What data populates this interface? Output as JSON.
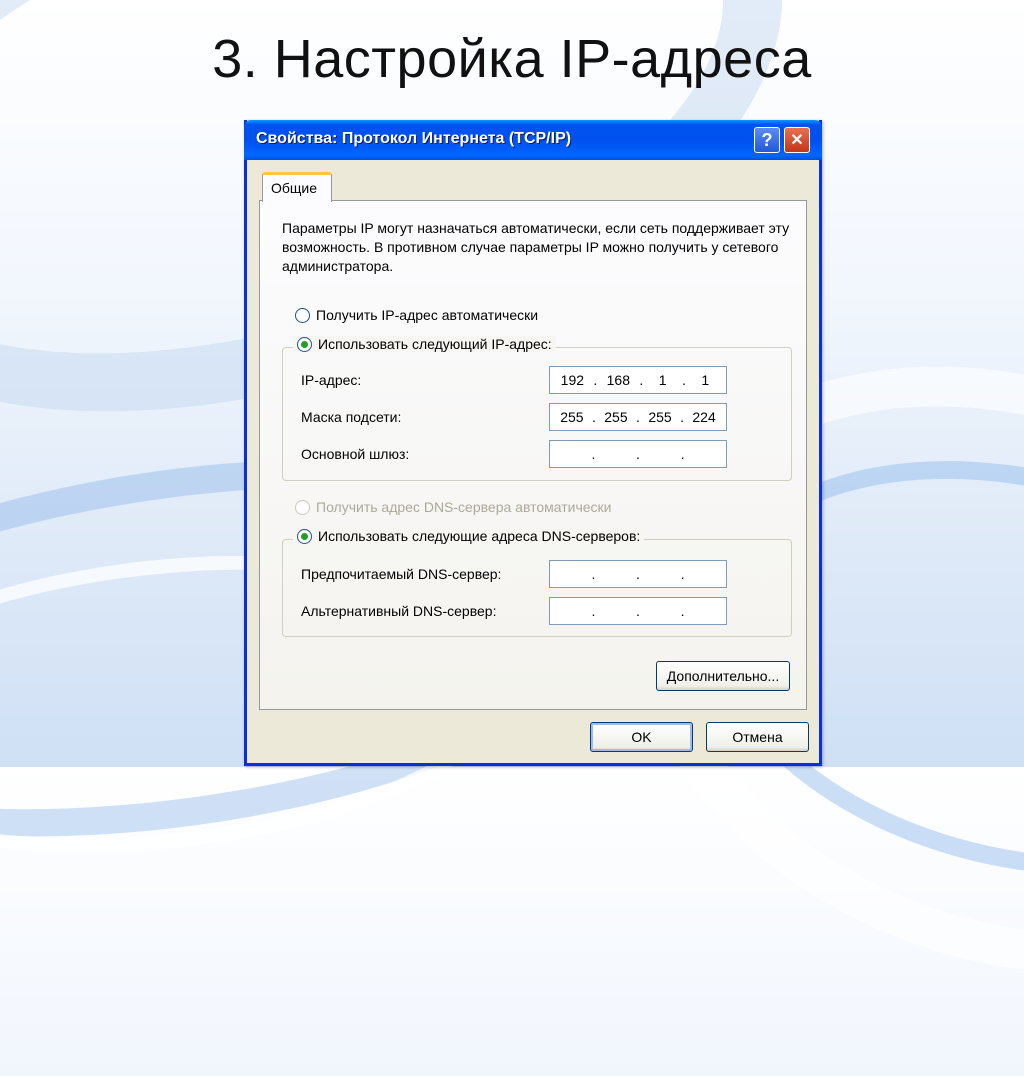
{
  "slide": {
    "title": "3. Настройка IP-адреса"
  },
  "dialog": {
    "title": "Свойства: Протокол Интернета (TCP/IP)",
    "help_label": "?",
    "close_label": "✕",
    "tab_label": "Общие",
    "description": "Параметры IP могут назначаться автоматически, если сеть поддерживает эту возможность. В противном случае параметры IP можно получить у сетевого администратора.",
    "ip_section": {
      "auto_label": "Получить IP-адрес автоматически",
      "auto_selected": false,
      "manual_label": "Использовать следующий IP-адрес:",
      "manual_selected": true,
      "fields": [
        {
          "label": "IP-адрес:",
          "octets": [
            "192",
            "168",
            "1",
            "1"
          ]
        },
        {
          "label": "Маска подсети:",
          "octets": [
            "255",
            "255",
            "255",
            "224"
          ]
        },
        {
          "label": "Основной шлюз:",
          "octets": [
            "",
            "",
            "",
            ""
          ]
        }
      ]
    },
    "dns_section": {
      "auto_label": "Получить адрес DNS-сервера автоматически",
      "auto_enabled": false,
      "manual_label": "Использовать следующие адреса DNS-серверов:",
      "manual_selected": true,
      "fields": [
        {
          "label": "Предпочитаемый DNS-сервер:",
          "octets": [
            "",
            "",
            "",
            ""
          ]
        },
        {
          "label": "Альтернативный DNS-сервер:",
          "octets": [
            "",
            "",
            "",
            ""
          ]
        }
      ]
    },
    "advanced_label": "Дополнительно...",
    "ok_label": "OK",
    "cancel_label": "Отмена"
  }
}
